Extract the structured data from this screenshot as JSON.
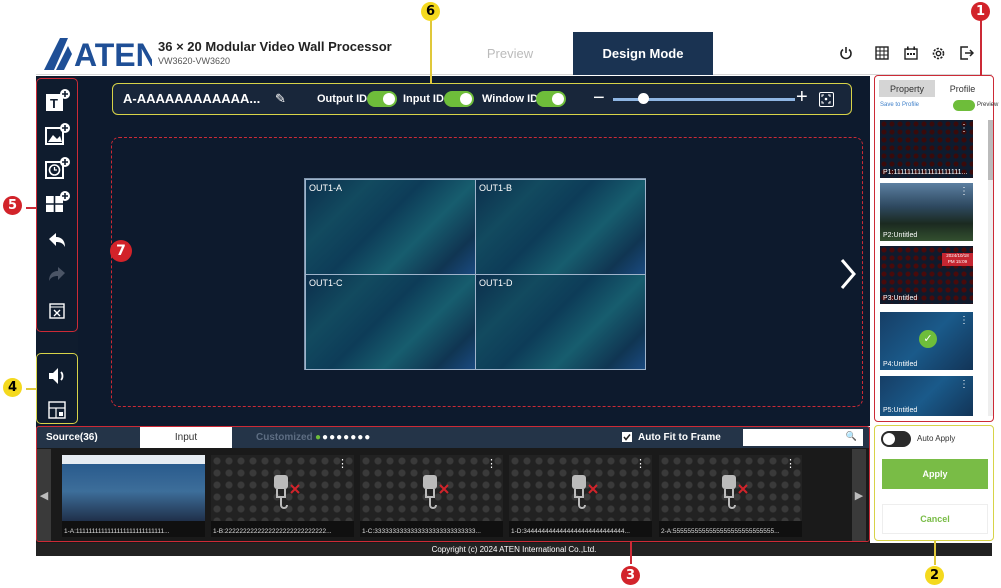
{
  "header": {
    "title": "36 × 20 Modular Video Wall Processor",
    "subtitle": "VW3620-VW3620",
    "logo": "ATEN",
    "tabs": [
      "Preview",
      "Design Mode"
    ],
    "active_tab": "Design Mode",
    "icons": [
      "power-icon",
      "grid-icon",
      "calendar-icon",
      "gear-icon",
      "logout-icon"
    ]
  },
  "toolbar": {
    "layout_name": "A-AAAAAAAAAAAA...",
    "toggles": [
      {
        "label": "Output ID",
        "on": true
      },
      {
        "label": "Input ID",
        "on": true
      },
      {
        "label": "Window ID",
        "on": true
      }
    ],
    "zoom_level": 0.17
  },
  "left_tools": [
    "add-text-icon",
    "add-image-icon",
    "add-clock-icon",
    "add-window-icon",
    "undo-icon",
    "redo-icon",
    "clear-icon"
  ],
  "left_tools_bottom": [
    "audio-icon",
    "layout-icon"
  ],
  "wall": {
    "cells": [
      "OUT1-A",
      "OUT1-B",
      "OUT1-C",
      "OUT1-D"
    ]
  },
  "right_panel": {
    "tabs": [
      "Property",
      "Profile"
    ],
    "save_to_profile": "Save to Profile",
    "preview_label": "Preview",
    "profiles": [
      "P1:11111111111111111111...",
      "P2:Untitled",
      "P3:Untitled",
      "P4:Untitled",
      "P5:Untitled"
    ],
    "p3_overlay_date": "2024/10/18",
    "p3_overlay_time": "PM 15:09"
  },
  "source": {
    "tab_source": "Source(36)",
    "tab_input": "Input",
    "tab_customized": "Customized",
    "auto_fit": "Auto Fit to Frame",
    "items": [
      "1-A:1111111111111111111111111111...",
      "1-B:2222222222222222222222222222...",
      "1-C:3333333333333333333333333333...",
      "1-D:3444444444444444444444444444...",
      "2-A:5555555555555555555555555555..."
    ]
  },
  "apply_panel": {
    "auto_apply": "Auto Apply",
    "apply": "Apply",
    "cancel": "Cancel"
  },
  "footer": "Copyright (c) 2024 ATEN International Co.,Ltd.",
  "callouts": [
    "1",
    "2",
    "3",
    "4",
    "5",
    "6",
    "7"
  ],
  "colors": {
    "design_tab": "#1a3352",
    "accent_green": "#79bc46",
    "callout_red": "#d2232a",
    "callout_yellow": "#f4d91e"
  }
}
